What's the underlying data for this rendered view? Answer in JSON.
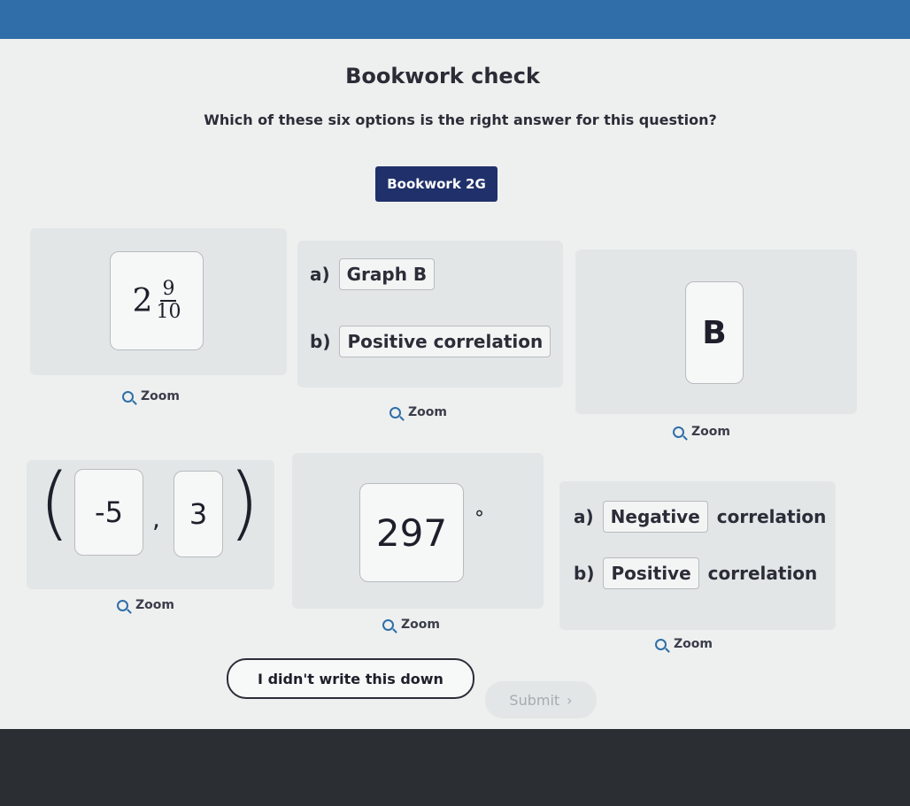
{
  "header": {
    "title": "Bookwork check",
    "instruction": "Which of these six options is the right answer for this question?",
    "code": "Bookwork 2G"
  },
  "options": {
    "opt1": {
      "whole": "2",
      "numerator": "9",
      "denominator": "10",
      "zoom": "Zoom"
    },
    "opt2": {
      "a_label": "a)",
      "a_value": "Graph B",
      "b_label": "b)",
      "b_value": "Positive correlation",
      "zoom": "Zoom"
    },
    "opt3": {
      "value": "B",
      "zoom": "Zoom"
    },
    "opt4": {
      "open": "(",
      "x": "-5",
      "sep": ",",
      "y": "3",
      "close": ")",
      "zoom": "Zoom"
    },
    "opt5": {
      "value": "297",
      "unit": "°",
      "zoom": "Zoom"
    },
    "opt6": {
      "a_label": "a)",
      "a_value": "Negative",
      "a_suffix": "correlation",
      "b_label": "b)",
      "b_value": "Positive",
      "b_suffix": "correlation",
      "zoom": "Zoom"
    }
  },
  "actions": {
    "didnt_write": "I didn't write this down",
    "submit": "Submit",
    "submit_chevron": "›"
  },
  "colors": {
    "topbar": "#2f6ea8",
    "pill": "#20306a",
    "card": "#e3e6e7"
  }
}
